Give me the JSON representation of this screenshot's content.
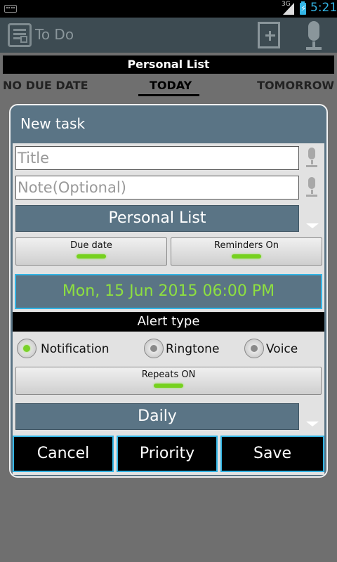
{
  "status_bar": {
    "network": "3G",
    "time": "5:21"
  },
  "action_bar": {
    "title": "To Do"
  },
  "list": {
    "header": "Personal List",
    "tabs": [
      {
        "label": "NO DUE DATE"
      },
      {
        "label": "TODAY"
      },
      {
        "label": "TOMORROW"
      }
    ],
    "selected_tab": "TODAY"
  },
  "dialog": {
    "title": "New task",
    "title_placeholder": "Title",
    "note_placeholder": "Note(Optional)",
    "list_select": "Personal List",
    "due_date_label": "Due date",
    "reminders_label": "Reminders On",
    "datetime": "Mon, 15 Jun 2015 06:00 PM",
    "alert_type_label": "Alert type",
    "alert_options": [
      {
        "label": "Notification",
        "selected": true
      },
      {
        "label": "Ringtone",
        "selected": false
      },
      {
        "label": "Voice",
        "selected": false
      }
    ],
    "repeats_label": "Repeats ON",
    "repeat_select": "Daily",
    "buttons": {
      "cancel": "Cancel",
      "priority": "Priority",
      "save": "Save"
    }
  },
  "colors": {
    "accent": "#33b5e5",
    "dialog_header": "#5a7485",
    "toggle_on": "#76d11e",
    "date_text": "#8ee040"
  }
}
